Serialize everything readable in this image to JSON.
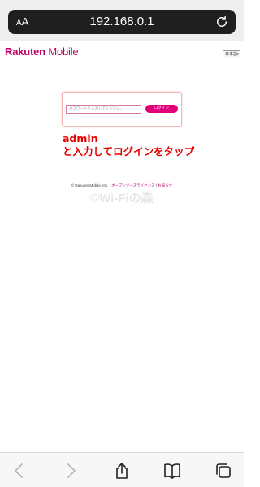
{
  "browser": {
    "text_size_label_small": "A",
    "text_size_label_large": "A",
    "url": "192.168.0.1"
  },
  "header": {
    "logo_brand": "Rakuten",
    "logo_product": "Mobile",
    "language_selected": "日本語"
  },
  "login": {
    "password_placeholder": "パスワードを入力してください。",
    "login_button_label": "ログイン"
  },
  "annotation": {
    "line1": "admin",
    "line2": "と入力してログインをタップ"
  },
  "footer": {
    "copyright": "© Rakuten Mobile, Inc.",
    "separator1": " | ",
    "open_source_link": "オープンソースライセンス",
    "separator2": " | ",
    "notice_link": "お知らせ"
  },
  "watermark": {
    "text": "©Wi-Fiの森"
  },
  "colors": {
    "brand": "#bf0066",
    "button": "#e2007a",
    "annotation": "#e60000"
  },
  "toolbar_icons": [
    "back-icon",
    "forward-icon",
    "share-icon",
    "bookmarks-icon",
    "tabs-icon"
  ]
}
